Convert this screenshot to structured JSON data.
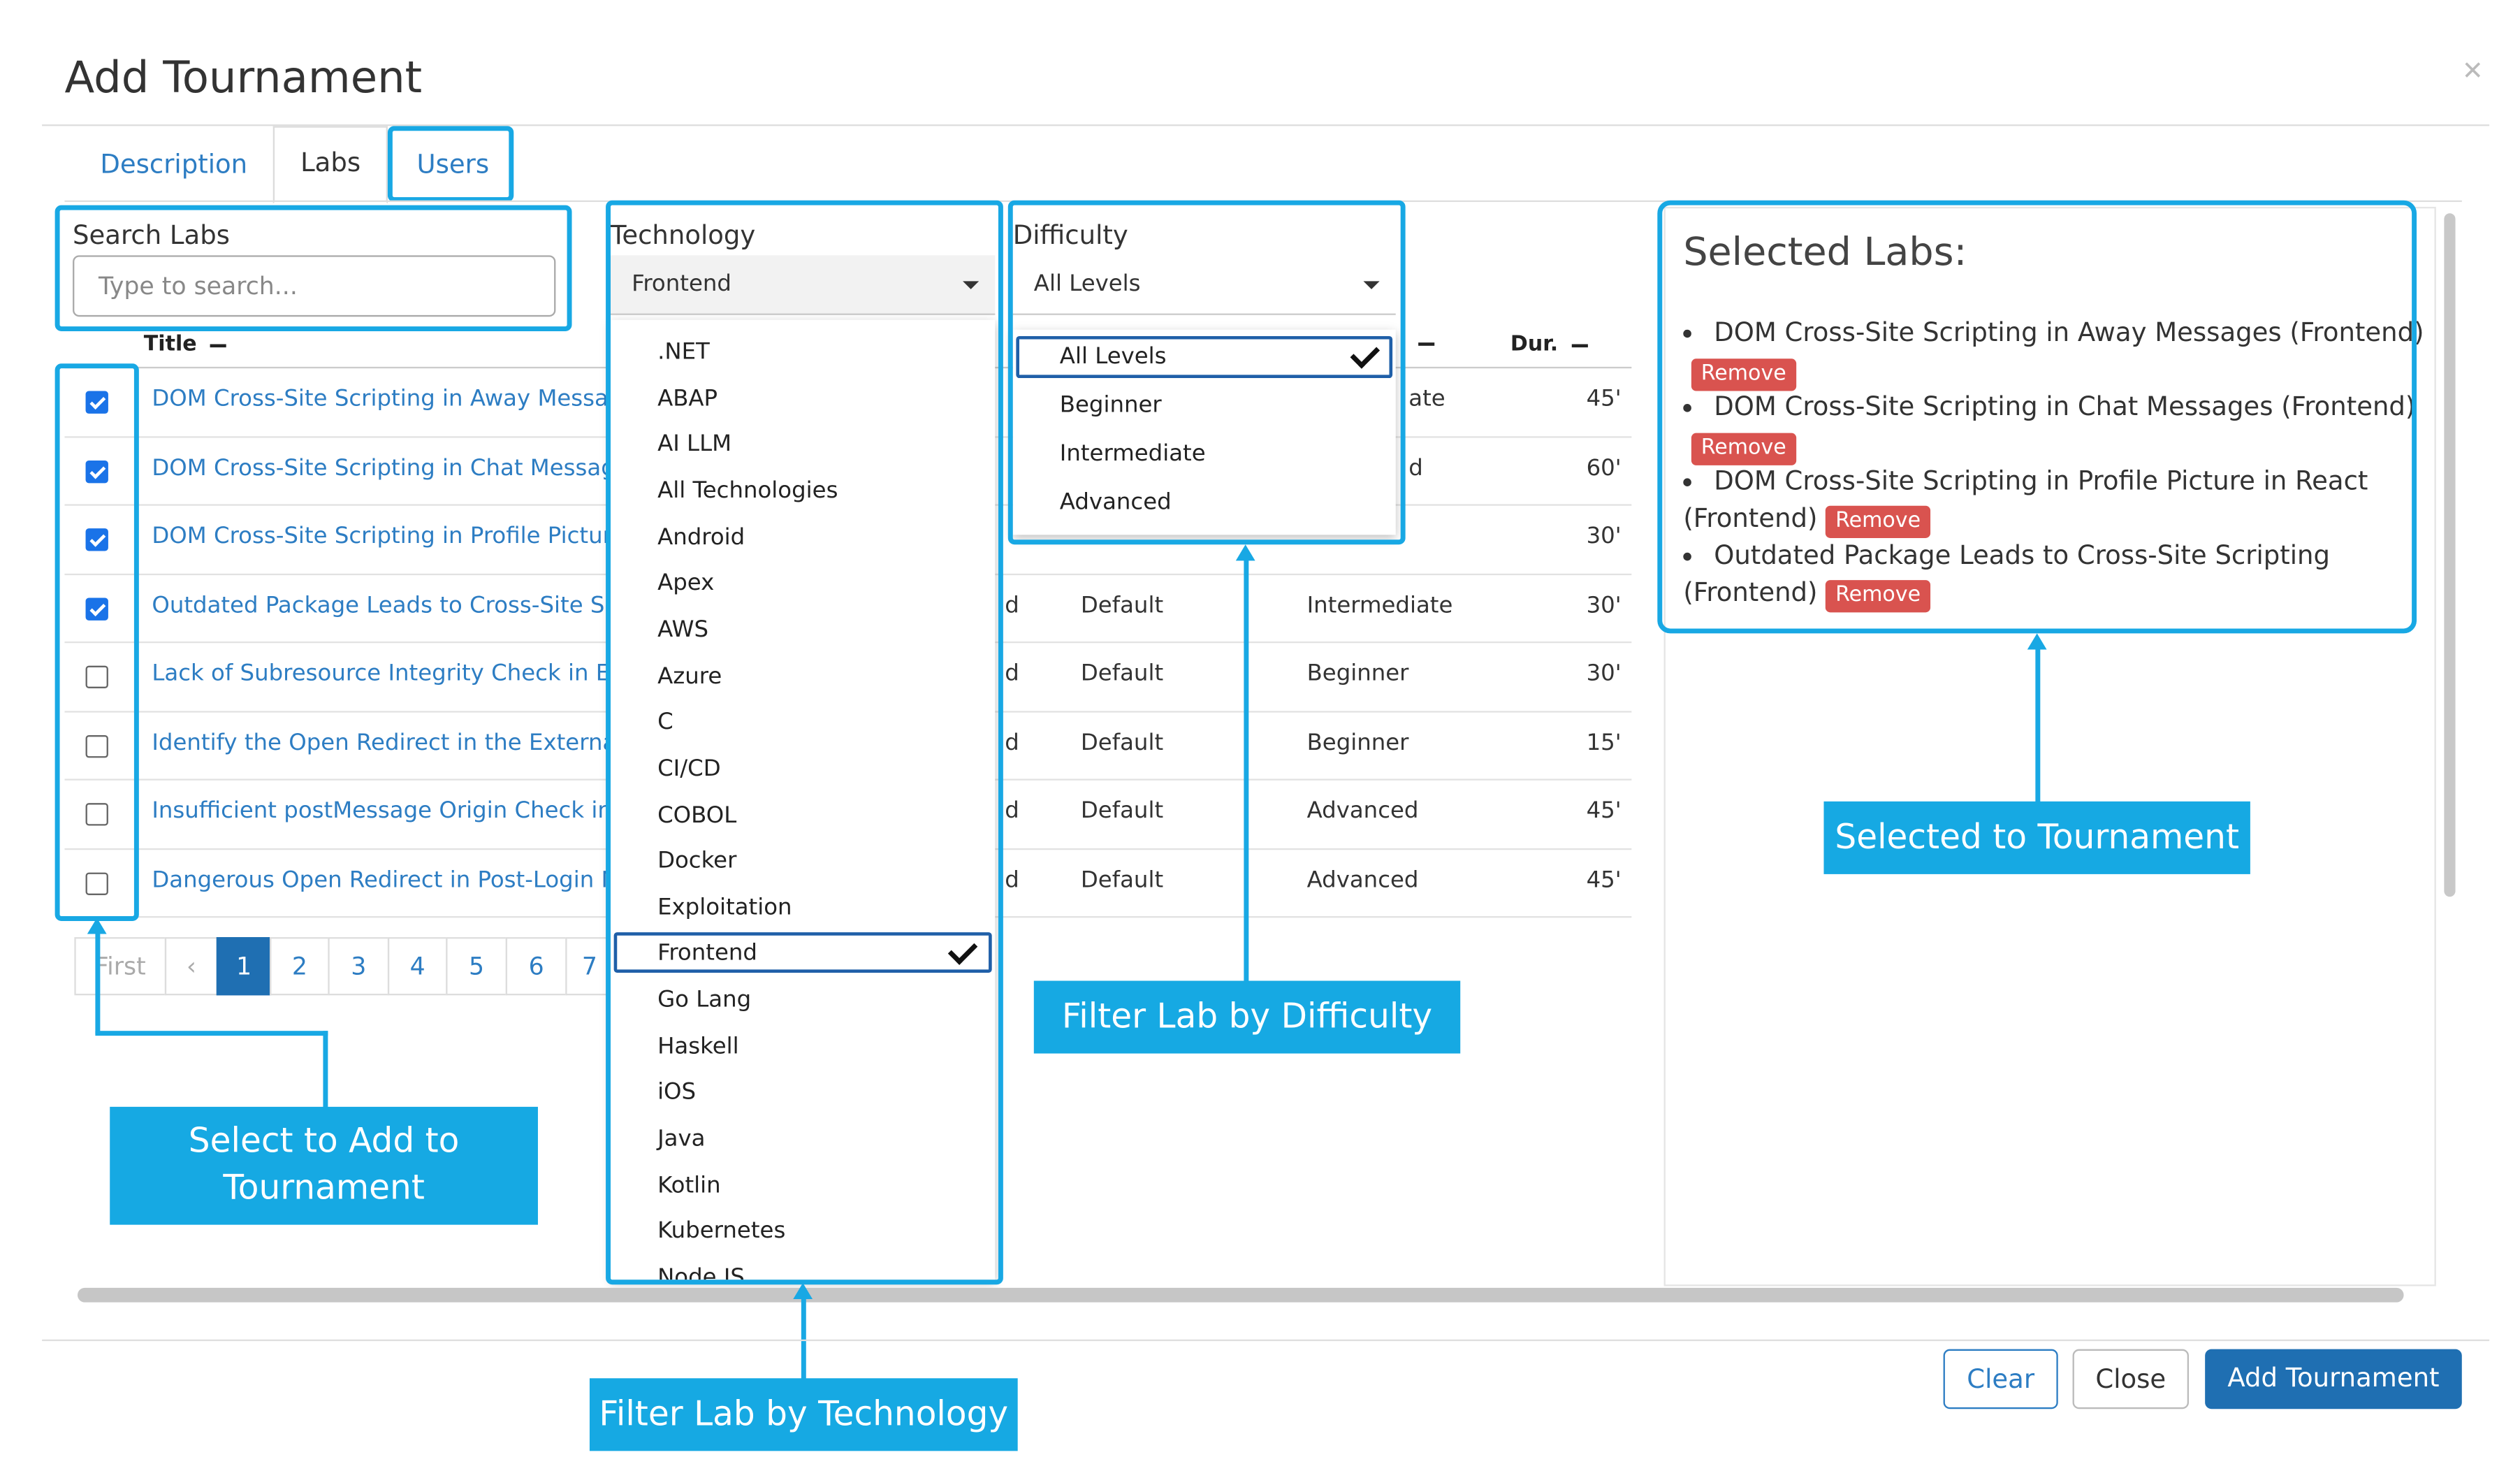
{
  "dialog": {
    "title": "Add Tournament"
  },
  "tabs": [
    {
      "label": "Description"
    },
    {
      "label": "Labs"
    },
    {
      "label": "Users"
    }
  ],
  "search": {
    "label": "Search Labs",
    "placeholder": "Type to search..."
  },
  "technology": {
    "label": "Technology",
    "selected": "Frontend",
    "options": [
      ".NET",
      "ABAP",
      "AI LLM",
      "All Technologies",
      "Android",
      "Apex",
      "AWS",
      "Azure",
      "C",
      "CI/CD",
      "COBOL",
      "Docker",
      "Exploitation",
      "Frontend",
      "Go Lang",
      "Haskell",
      "iOS",
      "Java",
      "Kotlin",
      "Kubernetes",
      "Node JS"
    ]
  },
  "difficulty": {
    "label": "Difficulty",
    "selected": "All Levels",
    "options": [
      "All Levels",
      "Beginner",
      "Intermediate",
      "Advanced"
    ]
  },
  "table": {
    "headers": {
      "title": "Title",
      "duration": "Dur."
    },
    "rows": [
      {
        "checked": true,
        "title": "DOM Cross-Site Scripting in Away Messages (Frontend)",
        "tech": "",
        "type": "",
        "level": "ate",
        "dur": "45'"
      },
      {
        "checked": true,
        "title": "DOM Cross-Site Scripting in Chat Messages (Frontend)",
        "tech": "",
        "type": "",
        "level": "d",
        "dur": "60'"
      },
      {
        "checked": true,
        "title": "DOM Cross-Site Scripting in Profile Picture in React (Frontend)",
        "tech": "",
        "type": "",
        "level": "",
        "dur": "30'"
      },
      {
        "checked": true,
        "title": "Outdated Package Leads to Cross-Site Scripting (Frontend)",
        "tech": "d",
        "type": "Default",
        "level": "Intermediate",
        "dur": "30'"
      },
      {
        "checked": false,
        "title": "Lack of Subresource Integrity Check in External Scripts",
        "tech": "d",
        "type": "Default",
        "level": "Beginner",
        "dur": "30'"
      },
      {
        "checked": false,
        "title": "Identify the Open Redirect in the External URL",
        "tech": "d",
        "type": "Default",
        "level": "Beginner",
        "dur": "15'"
      },
      {
        "checked": false,
        "title": "Insufficient postMessage Origin Check in OAuth",
        "tech": "d",
        "type": "Default",
        "level": "Advanced",
        "dur": "45'"
      },
      {
        "checked": false,
        "title": "Dangerous Open Redirect in Post-Login Navigation",
        "tech": "d",
        "type": "Default",
        "level": "Advanced",
        "dur": "45'"
      }
    ]
  },
  "pagination": {
    "first": "First",
    "prev": "‹",
    "pages": [
      "1",
      "2",
      "3",
      "4",
      "5",
      "6",
      "7"
    ],
    "current": "1"
  },
  "selected": {
    "heading": "Selected Labs:",
    "items": [
      "DOM Cross-Site Scripting in Away Messages (Frontend)",
      "DOM Cross-Site Scripting in Chat Messages (Frontend)",
      "DOM Cross-Site Scripting in Profile Picture in React",
      "(Frontend)",
      "Outdated Package Leads to Cross-Site Scripting",
      "(Frontend)"
    ],
    "remove_label": "Remove"
  },
  "callouts": {
    "select_line1": "Select to Add to",
    "select_line2": "Tournament",
    "technology": "Filter Lab by Technology",
    "difficulty": "Filter Lab by Difficulty",
    "selected": "Selected to Tournament"
  },
  "footer": {
    "clear": "Clear",
    "close": "Close",
    "add": "Add Tournament"
  },
  "colors": {
    "accent": "#18a8e4",
    "primary": "#1f6fb2",
    "danger": "#d9534f",
    "link": "#2d7dc3"
  }
}
